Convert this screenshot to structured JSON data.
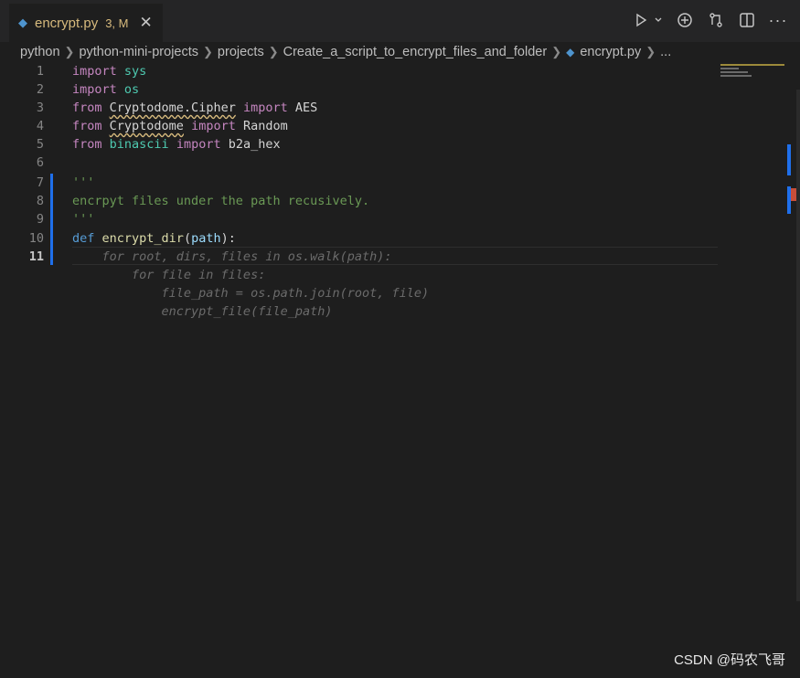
{
  "tab": {
    "filename": "encrypt.py",
    "badge": "3, M",
    "close": "✕"
  },
  "breadcrumb": {
    "items": [
      "python",
      "python-mini-projects",
      "projects",
      "Create_a_script_to_encrypt_files_and_folder",
      "encrypt.py",
      "..."
    ]
  },
  "editor": {
    "line_numbers": [
      "1",
      "2",
      "3",
      "4",
      "5",
      "6",
      "7",
      "8",
      "9",
      "10",
      "11"
    ],
    "lines": [
      {
        "t1": "import",
        "t2": " sys"
      },
      {
        "t1": "import",
        "t2": " os"
      },
      {
        "t1": "from",
        "t2": "Cryptodome.Cipher",
        "t3": "import",
        "t4": "AES"
      },
      {
        "t1": "from",
        "t2": "Cryptodome",
        "t3": "import",
        "t4": "Random"
      },
      {
        "t1": "from",
        "t2": "binascii",
        "t3": "import",
        "t4": "b2a_hex"
      },
      {},
      {
        "doc": "'''"
      },
      {
        "doc": "encrpyt files under the path recusively."
      },
      {
        "doc": "'''"
      },
      {
        "t1": "def",
        "t2": "encrypt_dir",
        "t3": "(",
        "t4": "path",
        "t5": "):"
      },
      {}
    ],
    "ghost": [
      "    for root, dirs, files in os.walk(path):",
      "        for file in files:",
      "            file_path = os.path.join(root, file)",
      "            encrypt_file(file_path)"
    ]
  },
  "colors": {
    "background": "#1e1e1e",
    "tab_modified": "#d7ba7d",
    "keyword": "#c586c0",
    "module": "#4ec9b0",
    "docstring": "#6a9955"
  },
  "watermark": "CSDN @码农飞哥"
}
